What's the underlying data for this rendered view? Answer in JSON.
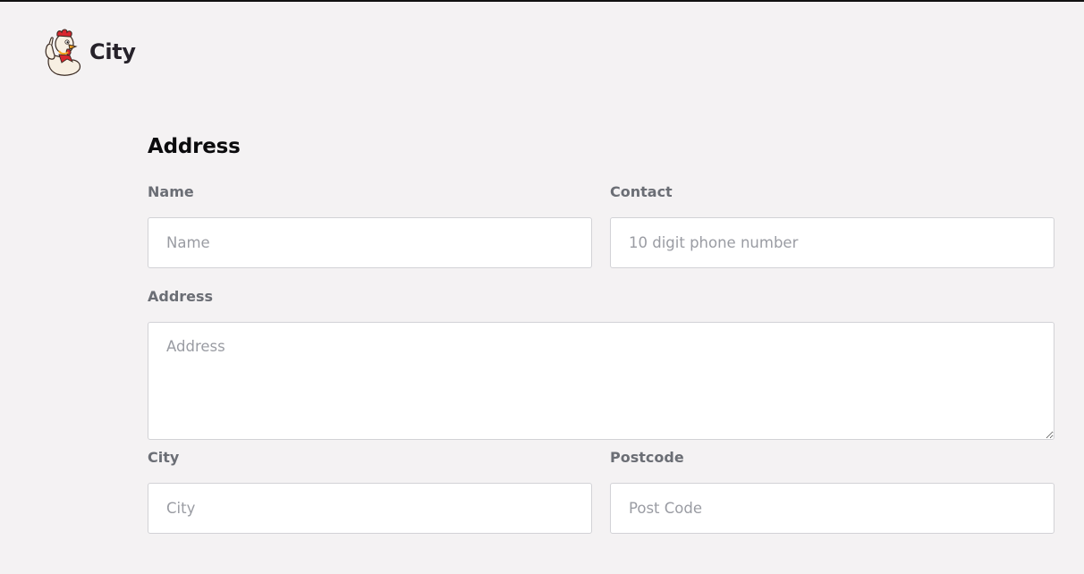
{
  "header": {
    "brand": "City",
    "logo_icon": "rooster-mascot-icon"
  },
  "form": {
    "title": "Address",
    "name": {
      "label": "Name",
      "placeholder": "Name",
      "value": ""
    },
    "contact": {
      "label": "Contact",
      "placeholder": "10 digit phone number",
      "value": ""
    },
    "address": {
      "label": "Address",
      "placeholder": "Address",
      "value": ""
    },
    "city": {
      "label": "City",
      "placeholder": "City",
      "value": ""
    },
    "postcode": {
      "label": "Postcode",
      "placeholder": "Post Code",
      "value": ""
    }
  },
  "colors": {
    "background": "#f4f2f3",
    "label": "#6b6e75",
    "heading": "#0b0b0d",
    "input_border": "#d2d2d6",
    "placeholder": "#9a9ca3"
  }
}
